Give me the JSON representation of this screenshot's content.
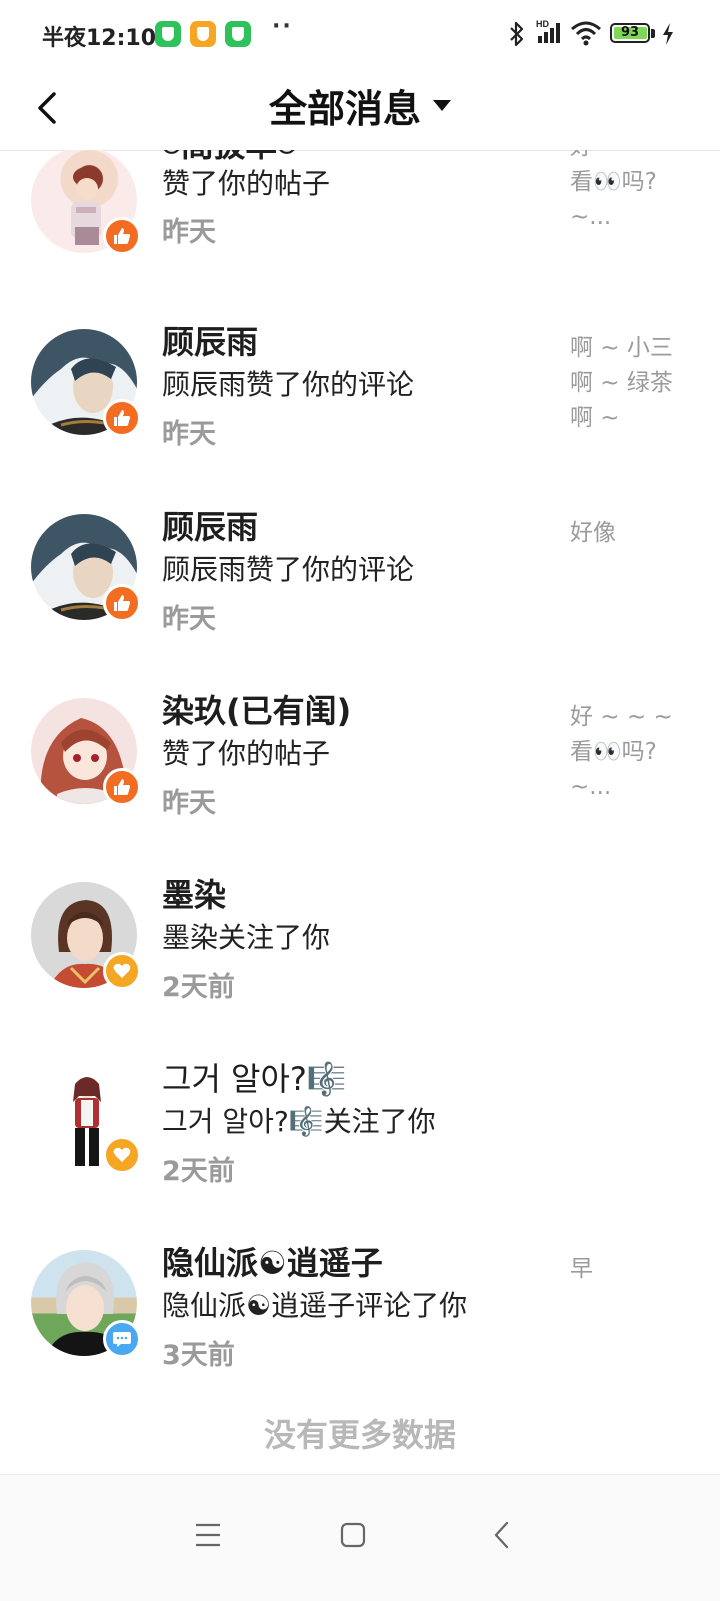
{
  "status_bar": {
    "time": "半夜12:10",
    "dots": "··",
    "battery": "93",
    "network_label": "HD"
  },
  "header": {
    "title": "全部消息",
    "back_icon": "chevron-left-icon",
    "dropdown_icon": "caret-down-icon"
  },
  "messages": [
    {
      "name": "⍥間拔萃⍥",
      "action": "赞了你的帖子",
      "time": "昨天",
      "type": "like",
      "preview": "好 ~ ~ ~\n看👀吗?\n~..."
    },
    {
      "name": "顾辰雨",
      "action": "顾辰雨赞了你的评论",
      "time": "昨天",
      "type": "like",
      "preview": "啊 ~ 小三\n啊 ~ 绿茶\n啊 ~"
    },
    {
      "name": "顾辰雨",
      "action": "顾辰雨赞了你的评论",
      "time": "昨天",
      "type": "like",
      "preview": "好像"
    },
    {
      "name": "染玖(已有闺)",
      "action": "赞了你的帖子",
      "time": "昨天",
      "type": "like",
      "preview": "好 ~ ~ ~\n看👀吗?\n~..."
    },
    {
      "name": "墨染",
      "action": "墨染关注了你",
      "time": "2天前",
      "type": "follow",
      "preview": ""
    },
    {
      "name": "그거 알아?🎼",
      "action": "그거 알아?🎼关注了你",
      "time": "2天前",
      "type": "follow",
      "preview": ""
    },
    {
      "name": "隐仙派☯逍遥子",
      "action": "隐仙派☯逍遥子评论了你",
      "time": "3天前",
      "type": "comment",
      "preview": "早"
    }
  ],
  "footer": {
    "no_more": "没有更多数据"
  },
  "colors": {
    "like": "#f26d21",
    "follow": "#f5a623",
    "comment": "#4aa8f0",
    "time": "#9a9a9a",
    "preview": "#9b9b9b"
  }
}
